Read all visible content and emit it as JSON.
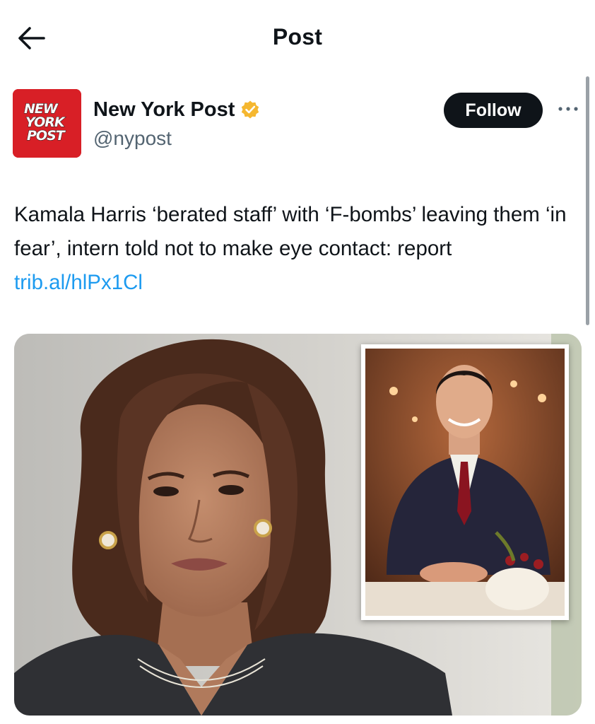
{
  "header": {
    "title": "Post",
    "back_icon": "arrow-left-icon"
  },
  "author": {
    "display_name": "New York Post",
    "handle": "@nypost",
    "verified": true,
    "verified_badge_color": "#f5b730",
    "avatar_color": "#d81f26",
    "avatar_logo_lines": [
      "NEW",
      "YORK",
      "POST"
    ],
    "follow_label": "Follow",
    "more_icon": "more-horizontal-icon"
  },
  "tweet": {
    "text": "Kamala Harris ‘berated staff’ with ‘F-bombs’ leaving them ‘in fear’, intern told not to make eye contact: report ",
    "link": "trib.al/hlPx1Cl",
    "link_color": "#1d9bf0"
  },
  "media": {
    "main_image": "portrait-woman-photo",
    "inset_image": "portrait-man-restaurant-photo"
  }
}
